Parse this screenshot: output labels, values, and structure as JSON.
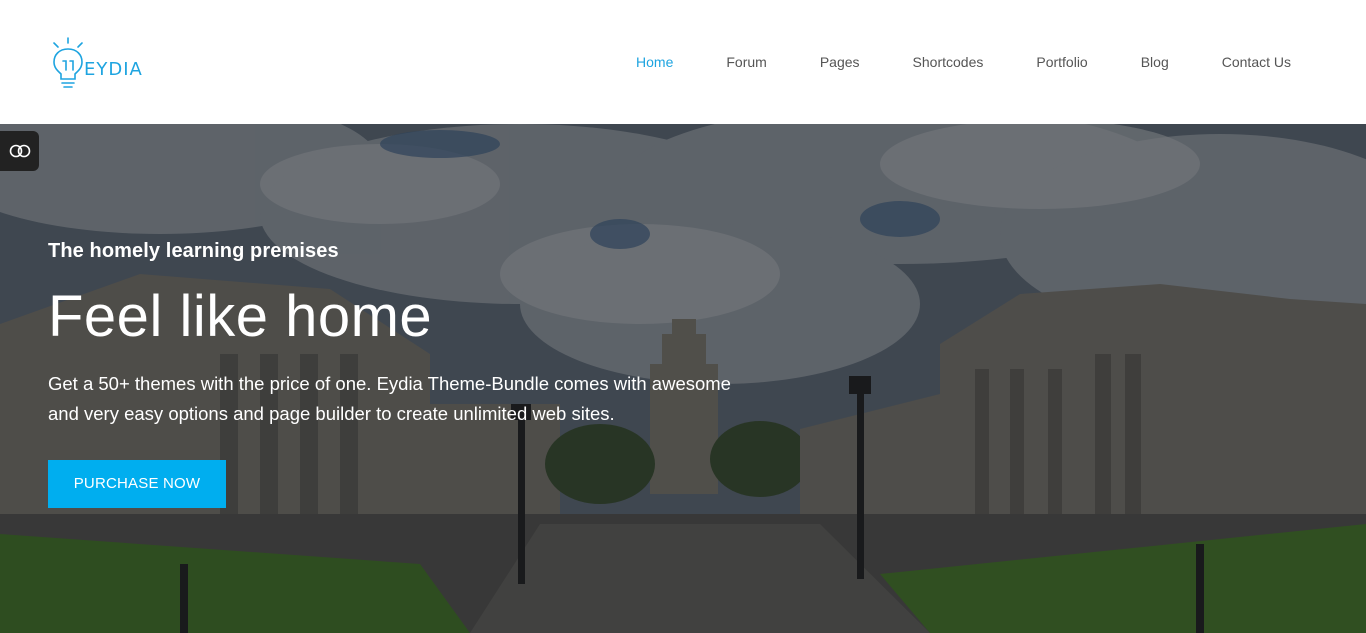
{
  "brand": {
    "logo_text": "EYDIA",
    "accent_color": "#1ea4e0"
  },
  "nav": {
    "items": [
      {
        "label": "Home",
        "active": true
      },
      {
        "label": "Forum",
        "active": false
      },
      {
        "label": "Pages",
        "active": false
      },
      {
        "label": "Shortcodes",
        "active": false
      },
      {
        "label": "Portfolio",
        "active": false
      },
      {
        "label": "Blog",
        "active": false
      },
      {
        "label": "Contact Us",
        "active": false
      }
    ]
  },
  "hero": {
    "subtitle": "The homely learning premises",
    "title": "Feel like home",
    "description": "Get a 50+ themes with the price of one. Eydia Theme-Bundle comes with awesome and very easy options and page builder to create unlimited web sites.",
    "cta_label": "PURCHASE NOW",
    "cta_color": "#00aeef",
    "toggle_icon": "toggle-icon"
  }
}
